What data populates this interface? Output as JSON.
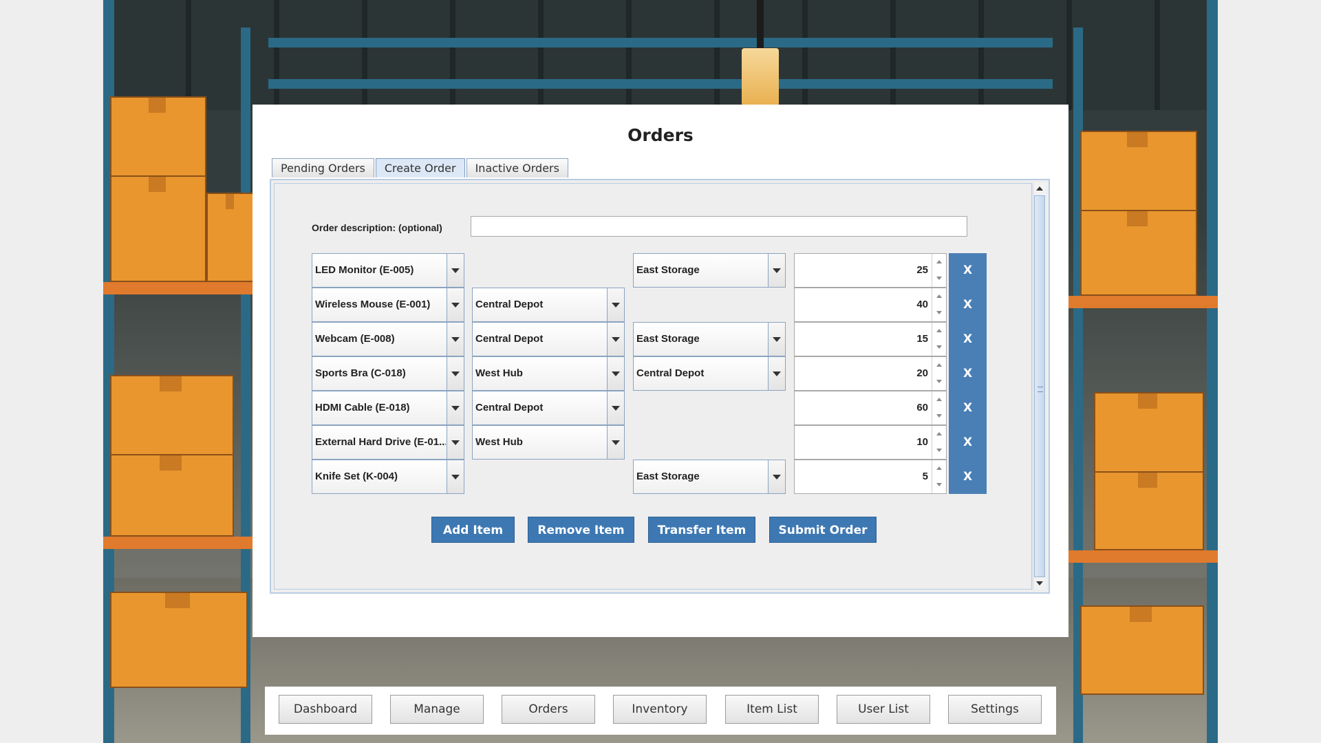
{
  "panel": {
    "title": "Orders"
  },
  "tabs": [
    {
      "label": "Pending Orders",
      "active": false
    },
    {
      "label": "Create Order",
      "active": true
    },
    {
      "label": "Inactive Orders",
      "active": false
    }
  ],
  "form": {
    "description_label": "Order description: (optional)",
    "description_value": ""
  },
  "rows": [
    {
      "item": "LED Monitor (E-005)",
      "from": "",
      "to": "East Storage",
      "quantity": "25",
      "remove_label": "X"
    },
    {
      "item": "Wireless Mouse (E-001)",
      "from": "Central Depot",
      "to": "",
      "quantity": "40",
      "remove_label": "X"
    },
    {
      "item": "Webcam (E-008)",
      "from": "Central Depot",
      "to": "East Storage",
      "quantity": "15",
      "remove_label": "X"
    },
    {
      "item": "Sports Bra (C-018)",
      "from": "West Hub",
      "to": "Central Depot",
      "quantity": "20",
      "remove_label": "X"
    },
    {
      "item": "HDMI Cable (E-018)",
      "from": "Central Depot",
      "to": "",
      "quantity": "60",
      "remove_label": "X"
    },
    {
      "item": "External Hard Drive (E-01...",
      "from": "West Hub",
      "to": "",
      "quantity": "10",
      "remove_label": "X"
    },
    {
      "item": "Knife Set (K-004)",
      "from": "",
      "to": "East Storage",
      "quantity": "5",
      "remove_label": "X"
    }
  ],
  "actions": {
    "add_item": "Add Item",
    "remove_item": "Remove Item",
    "transfer_item": "Transfer Item",
    "submit_order": "Submit Order"
  },
  "nav": {
    "dashboard": "Dashboard",
    "manage": "Manage",
    "orders": "Orders",
    "inventory": "Inventory",
    "item_list": "Item List",
    "user_list": "User List",
    "settings": "Settings"
  },
  "colors": {
    "accent_button": "#3d78b3",
    "remove_button": "#4a7fb5",
    "tab_border": "#b8cce3"
  }
}
